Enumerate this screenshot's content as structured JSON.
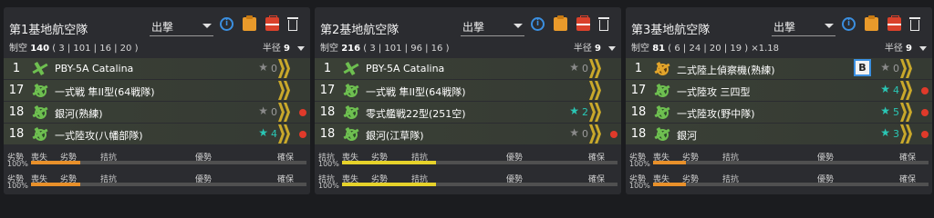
{
  "panels": [
    {
      "title": "第1基地航空隊",
      "mode": "出撃",
      "air_label": "制空",
      "air_value": "140",
      "air_detail": "( 3 | 101 | 16 | 20 )",
      "radius_label": "半径",
      "radius_value": "9",
      "slots": [
        {
          "num": "1",
          "name": "PBY-5A Catalina",
          "star": "★",
          "level": "0",
          "star_color": "gray",
          "icon": "plain"
        },
        {
          "num": "17",
          "name": "一式戦 隼II型(64戦隊)",
          "star": "",
          "level": "",
          "icon": "badge"
        },
        {
          "num": "18",
          "name": "銀河(熟練)",
          "star": "★",
          "level": "0",
          "star_color": "gray",
          "icon": "badge",
          "dot": true
        },
        {
          "num": "18",
          "name": "一式陸攻(八幡部隊)",
          "star": "★",
          "level": "4",
          "star_color": "teal",
          "icon": "badge",
          "dot": true
        }
      ],
      "bars": [
        {
          "left": "劣勢",
          "labels": [
            "喪失",
            "劣勢",
            "拮抗",
            "優勢",
            "確保"
          ],
          "pct": "100%",
          "fill": 0.18,
          "color": "#e8902a"
        },
        {
          "left": "劣勢",
          "labels": [
            "喪失",
            "劣勢",
            "拮抗",
            "優勢",
            "確保"
          ],
          "pct": "100%",
          "fill": 0.18,
          "color": "#e8902a"
        }
      ]
    },
    {
      "title": "第2基地航空隊",
      "mode": "出撃",
      "air_label": "制空",
      "air_value": "216",
      "air_detail": "( 3 | 101 | 96 | 16 )",
      "radius_label": "半径",
      "radius_value": "9",
      "slots": [
        {
          "num": "1",
          "name": "PBY-5A Catalina",
          "star": "★",
          "level": "0",
          "star_color": "gray",
          "icon": "plain"
        },
        {
          "num": "17",
          "name": "一式戦 隼II型(64戦隊)",
          "star": "",
          "level": "",
          "icon": "badge"
        },
        {
          "num": "18",
          "name": "零式艦戦22型(251空)",
          "star": "★",
          "level": "2",
          "star_color": "teal",
          "icon": "badge"
        },
        {
          "num": "18",
          "name": "銀河(江草隊)",
          "star": "★",
          "level": "0",
          "star_color": "gray",
          "icon": "badge",
          "dot": true
        }
      ],
      "bars": [
        {
          "left": "拮抗",
          "labels": [
            "喪失",
            "劣勢",
            "拮抗",
            "優勢",
            "確保"
          ],
          "pct": "100%",
          "fill": 0.34,
          "color": "#e6d22a"
        },
        {
          "left": "拮抗",
          "labels": [
            "喪失",
            "劣勢",
            "拮抗",
            "優勢",
            "確保"
          ],
          "pct": "100%",
          "fill": 0.34,
          "color": "#e6d22a"
        }
      ]
    },
    {
      "title": "第3基地航空隊",
      "mode": "出撃",
      "air_label": "制空",
      "air_value": "81",
      "air_detail": "( 6 | 24 | 20 | 19 ) ×1.18",
      "radius_label": "半径",
      "radius_value": "9",
      "slots": [
        {
          "num": "1",
          "name": "二式陸上偵察機(熟練)",
          "star": "★",
          "level": "0",
          "star_color": "gray",
          "icon": "gold",
          "b": "B"
        },
        {
          "num": "17",
          "name": "一式陸攻 三四型",
          "star": "★",
          "level": "4",
          "star_color": "teal",
          "icon": "badge",
          "dot": true
        },
        {
          "num": "18",
          "name": "一式陸攻(野中隊)",
          "star": "★",
          "level": "5",
          "star_color": "teal",
          "icon": "badge",
          "dot": true
        },
        {
          "num": "18",
          "name": "銀河",
          "star": "★",
          "level": "3",
          "star_color": "teal",
          "icon": "badge",
          "dot": true
        }
      ],
      "bars": [
        {
          "left": "劣勢",
          "labels": [
            "喪失",
            "劣勢",
            "拮抗",
            "優勢",
            "確保"
          ],
          "pct": "100%",
          "fill": 0.12,
          "color": "#e8902a"
        },
        {
          "left": "劣勢",
          "labels": [
            "喪失",
            "劣勢",
            "拮抗",
            "優勢",
            "確保"
          ],
          "pct": "100%",
          "fill": 0.12,
          "color": "#e8902a"
        }
      ]
    }
  ]
}
